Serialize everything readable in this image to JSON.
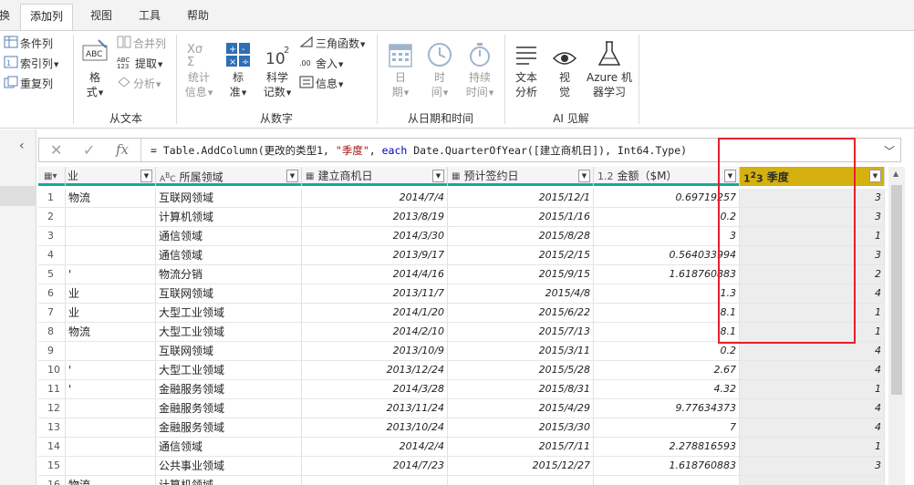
{
  "tabs": [
    {
      "label": "换",
      "active": false
    },
    {
      "label": "添加列",
      "active": true
    },
    {
      "label": "视图",
      "active": false
    },
    {
      "label": "工具",
      "active": false
    },
    {
      "label": "帮助",
      "active": false
    }
  ],
  "ribbon": {
    "general": {
      "conditional_column": "条件列",
      "index_column": "索引列",
      "duplicate_column": "重复列"
    },
    "from_text": {
      "format_line1": "格",
      "format_line2": "式",
      "merge_columns": "合并列",
      "extract": "提取",
      "parse": "分析",
      "group_label": "从文本"
    },
    "from_number": {
      "statistics_line1": "统计",
      "statistics_line2": "信息",
      "standard_line1": "标",
      "standard_line2": "准",
      "scientific_line1": "科学",
      "scientific_line2": "记数",
      "trigonometry": "三角函数",
      "rounding": "舍入",
      "information": "信息",
      "group_label": "从数字"
    },
    "from_date_time": {
      "date_line1": "日",
      "date_line2": "期",
      "time_line1": "时",
      "time_line2": "间",
      "duration_line1": "持续",
      "duration_line2": "时间",
      "group_label": "从日期和时间"
    },
    "ai_insights": {
      "text_analytics_line1": "文本",
      "text_analytics_line2": "分析",
      "vision_line1": "视",
      "vision_line2": "觉",
      "azure_ml_line1": "Azure 机",
      "azure_ml_line2": "器学习",
      "group_label": "AI 见解"
    }
  },
  "formula_bar": {
    "fx": "fx",
    "text_prefix": "= Table.AddColumn(更改的类型1, ",
    "text_string": "\"季度\"",
    "text_middle": ", ",
    "text_keyword": "each",
    "text_suffix": " Date.QuarterOfYear([建立商机日]), Int64.Type)"
  },
  "columns": [
    {
      "name": "业",
      "type_icon": "▦",
      "type": "table"
    },
    {
      "name": "所属领域",
      "type_icon": "ABC",
      "type": "text"
    },
    {
      "name": "建立商机日",
      "type_icon": "▦",
      "type": "date"
    },
    {
      "name": "预计签约日",
      "type_icon": "▦",
      "type": "date"
    },
    {
      "name": "金额（$M）",
      "type_icon": "1.2",
      "type": "decimal"
    },
    {
      "name": "季度",
      "type_icon": "1²3",
      "type": "integer"
    }
  ],
  "rows": [
    {
      "n": "1",
      "a": "物流",
      "b": "互联网领域",
      "c": "2014/7/4",
      "d": "2015/12/1",
      "e": "0.69719257",
      "f": "3"
    },
    {
      "n": "2",
      "a": "",
      "b": "计算机领域",
      "c": "2013/8/19",
      "d": "2015/1/16",
      "e": "0.2",
      "f": "3"
    },
    {
      "n": "3",
      "a": "",
      "b": "通信领域",
      "c": "2014/3/30",
      "d": "2015/8/28",
      "e": "3",
      "f": "1"
    },
    {
      "n": "4",
      "a": "",
      "b": "通信领域",
      "c": "2013/9/17",
      "d": "2015/2/15",
      "e": "0.564033994",
      "f": "3"
    },
    {
      "n": "5",
      "a": "'",
      "b": "物流分销",
      "c": "2014/4/16",
      "d": "2015/9/15",
      "e": "1.618760883",
      "f": "2"
    },
    {
      "n": "6",
      "a": "业",
      "b": "互联网领域",
      "c": "2013/11/7",
      "d": "2015/4/8",
      "e": "1.3",
      "f": "4"
    },
    {
      "n": "7",
      "a": "业",
      "b": "大型工业领域",
      "c": "2014/1/20",
      "d": "2015/6/22",
      "e": "8.1",
      "f": "1"
    },
    {
      "n": "8",
      "a": "物流",
      "b": "大型工业领域",
      "c": "2014/2/10",
      "d": "2015/7/13",
      "e": "8.1",
      "f": "1"
    },
    {
      "n": "9",
      "a": "",
      "b": "互联网领域",
      "c": "2013/10/9",
      "d": "2015/3/11",
      "e": "0.2",
      "f": "4"
    },
    {
      "n": "10",
      "a": "'",
      "b": "大型工业领域",
      "c": "2013/12/24",
      "d": "2015/5/28",
      "e": "2.67",
      "f": "4"
    },
    {
      "n": "11",
      "a": "'",
      "b": "金融服务领域",
      "c": "2014/3/28",
      "d": "2015/8/31",
      "e": "4.32",
      "f": "1"
    },
    {
      "n": "12",
      "a": "",
      "b": "金融服务领域",
      "c": "2013/11/24",
      "d": "2015/4/29",
      "e": "9.77634373",
      "f": "4"
    },
    {
      "n": "13",
      "a": "",
      "b": "金融服务领域",
      "c": "2013/10/24",
      "d": "2015/3/30",
      "e": "7",
      "f": "4"
    },
    {
      "n": "14",
      "a": "",
      "b": "通信领域",
      "c": "2014/2/4",
      "d": "2015/7/11",
      "e": "2.278816593",
      "f": "1"
    },
    {
      "n": "15",
      "a": "",
      "b": "公共事业领域",
      "c": "2014/7/23",
      "d": "2015/12/27",
      "e": "1.618760883",
      "f": "3"
    },
    {
      "n": "16",
      "a": "物流",
      "b": "计算机领域",
      "c": "",
      "d": "",
      "e": "",
      "f": ""
    }
  ],
  "colors": {
    "accent_teal": "#15a99d",
    "selected_column": "#d4b10f",
    "highlight_box": "#e5202b"
  }
}
